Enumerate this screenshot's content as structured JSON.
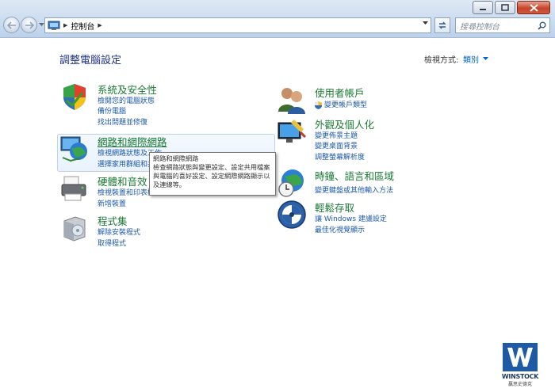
{
  "window": {
    "buttons": [
      "minimize",
      "maximize",
      "close"
    ]
  },
  "nav": {
    "back": "back-arrow",
    "forward": "forward-arrow"
  },
  "address": {
    "path": "控制台",
    "separator": "▶"
  },
  "search": {
    "placeholder": "搜尋控制台"
  },
  "page": {
    "title": "調整電腦設定",
    "view_by_label": "檢視方式:",
    "view_by_value": "類別"
  },
  "categories": {
    "system": {
      "title": "系統及安全性",
      "links": [
        "檢閱您的電腦狀態",
        "備份電腦",
        "找出問題並修復"
      ]
    },
    "network": {
      "title": "網路和網際網路",
      "links": [
        "檢視網路狀態及工作",
        "選擇家用群組和共用選項"
      ]
    },
    "hardware": {
      "title": "硬體和音效",
      "links": [
        "檢視裝置和印表機",
        "新增裝置"
      ]
    },
    "programs": {
      "title": "程式集",
      "links": [
        "解除安裝程式",
        "取得程式"
      ]
    },
    "users": {
      "title": "使用者帳戶",
      "links": [
        "變更帳戶類型"
      ]
    },
    "appearance": {
      "title": "外觀及個人化",
      "links": [
        "變更佈景主題",
        "變更桌面背景",
        "調整螢幕解析度"
      ]
    },
    "clock": {
      "title": "時鐘、語言和區域",
      "links": [
        "變更鍵盤或其他輸入方法"
      ]
    },
    "ease": {
      "title": "輕鬆存取",
      "links": [
        "讓 Windows 建議設定",
        "最佳化視覺顯示"
      ]
    }
  },
  "tooltip": {
    "title": "網路和網際網路",
    "body": "檢查網路狀態與變更設定、設定共用檔案與電腦的喜好設定、設定網際網路顯示以及連線等。"
  },
  "watermark": {
    "name": "WINSTOCK",
    "sub": "贏思史德克"
  }
}
